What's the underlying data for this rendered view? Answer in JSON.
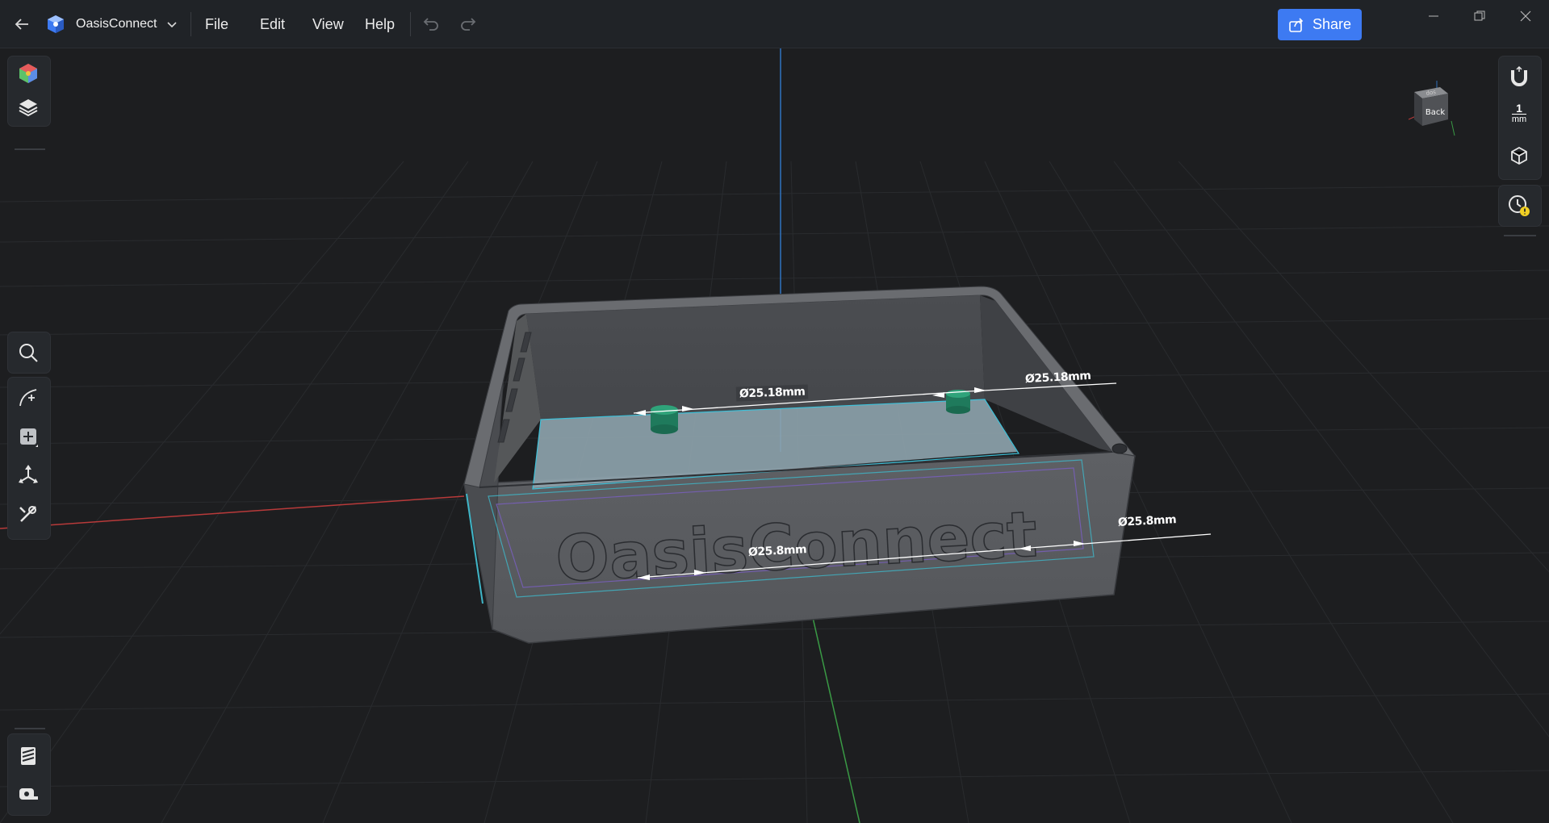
{
  "app": {
    "title": "OasisConnect",
    "menus": [
      "File",
      "Edit",
      "View",
      "Help"
    ],
    "share_label": "Share",
    "accent_color": "#3d7af2"
  },
  "right_toolbar": {
    "grid_size_value": "1",
    "grid_size_unit": "mm"
  },
  "view_cube": {
    "face_label": "Back",
    "top_label": "dos"
  },
  "model": {
    "emboss_text": "OasisConnect",
    "dimensions": [
      "Ø25.18mm",
      "Ø25.18mm",
      "Ø25.8mm",
      "Ø25.8mm"
    ]
  },
  "icons": {
    "back": "arrow-left-icon",
    "logo": "app-logo-icon",
    "dropdown": "chevron-down-icon",
    "undo": "undo-icon",
    "redo": "redo-icon",
    "share": "share-icon",
    "minimize": "minimize-icon",
    "restore": "restore-icon",
    "close": "close-icon"
  }
}
